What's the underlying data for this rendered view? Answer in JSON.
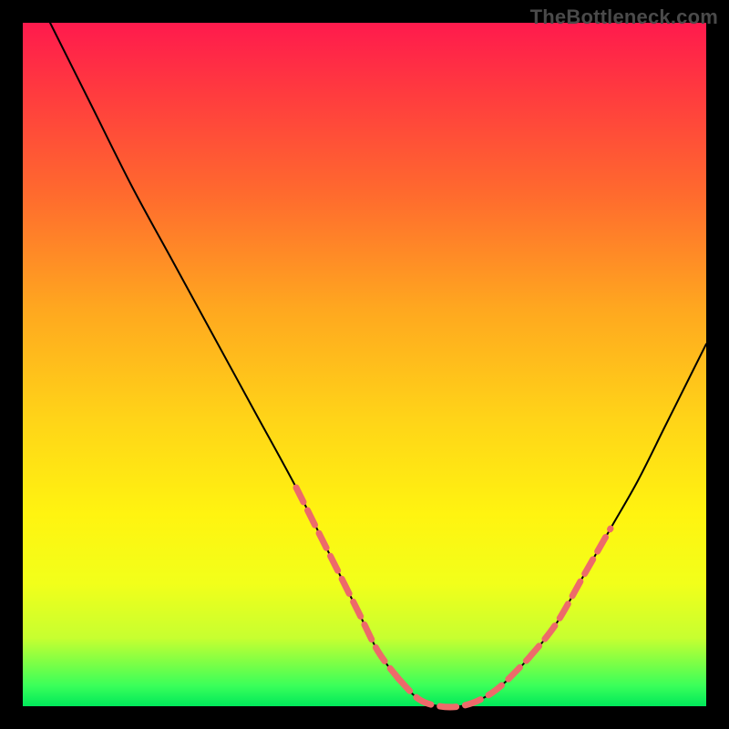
{
  "watermark": "TheBottleneck.com",
  "chart_data": {
    "type": "line",
    "title": "",
    "xlabel": "",
    "ylabel": "",
    "xlim": [
      0,
      100
    ],
    "ylim": [
      0,
      100
    ],
    "gradient_stops": [
      {
        "pos": 0,
        "color": "#ff1a4d"
      },
      {
        "pos": 10,
        "color": "#ff3a3f"
      },
      {
        "pos": 25,
        "color": "#ff6a2e"
      },
      {
        "pos": 42,
        "color": "#ffa81f"
      },
      {
        "pos": 58,
        "color": "#ffd418"
      },
      {
        "pos": 72,
        "color": "#fff410"
      },
      {
        "pos": 82,
        "color": "#f2ff1a"
      },
      {
        "pos": 90,
        "color": "#c7ff30"
      },
      {
        "pos": 97,
        "color": "#3aff5a"
      },
      {
        "pos": 100,
        "color": "#00e85a"
      }
    ],
    "series": [
      {
        "name": "curve",
        "stroke": "#000000",
        "x": [
          4,
          10,
          16,
          22,
          28,
          34,
          40,
          45,
          49,
          52,
          55,
          58,
          61,
          64,
          67,
          70,
          74,
          78,
          82,
          86,
          90,
          94,
          98,
          100
        ],
        "y": [
          100,
          88,
          76,
          65,
          54,
          43,
          32,
          22,
          14,
          8,
          4,
          1,
          0,
          0,
          1,
          3,
          7,
          12,
          19,
          26,
          33,
          41,
          49,
          53
        ]
      }
    ],
    "highlight_segments": {
      "stroke": "#ed6a6a",
      "width": 7,
      "dash": "18 10",
      "paths": [
        {
          "x": [
            40,
            45,
            49,
            52,
            55
          ],
          "y": [
            32,
            22,
            14,
            8,
            4
          ]
        },
        {
          "x": [
            55,
            58,
            61,
            64,
            67,
            70,
            74
          ],
          "y": [
            4,
            1,
            0,
            0,
            1,
            3,
            7
          ]
        },
        {
          "x": [
            74,
            78,
            82,
            86
          ],
          "y": [
            7,
            12,
            19,
            26
          ]
        }
      ]
    }
  }
}
